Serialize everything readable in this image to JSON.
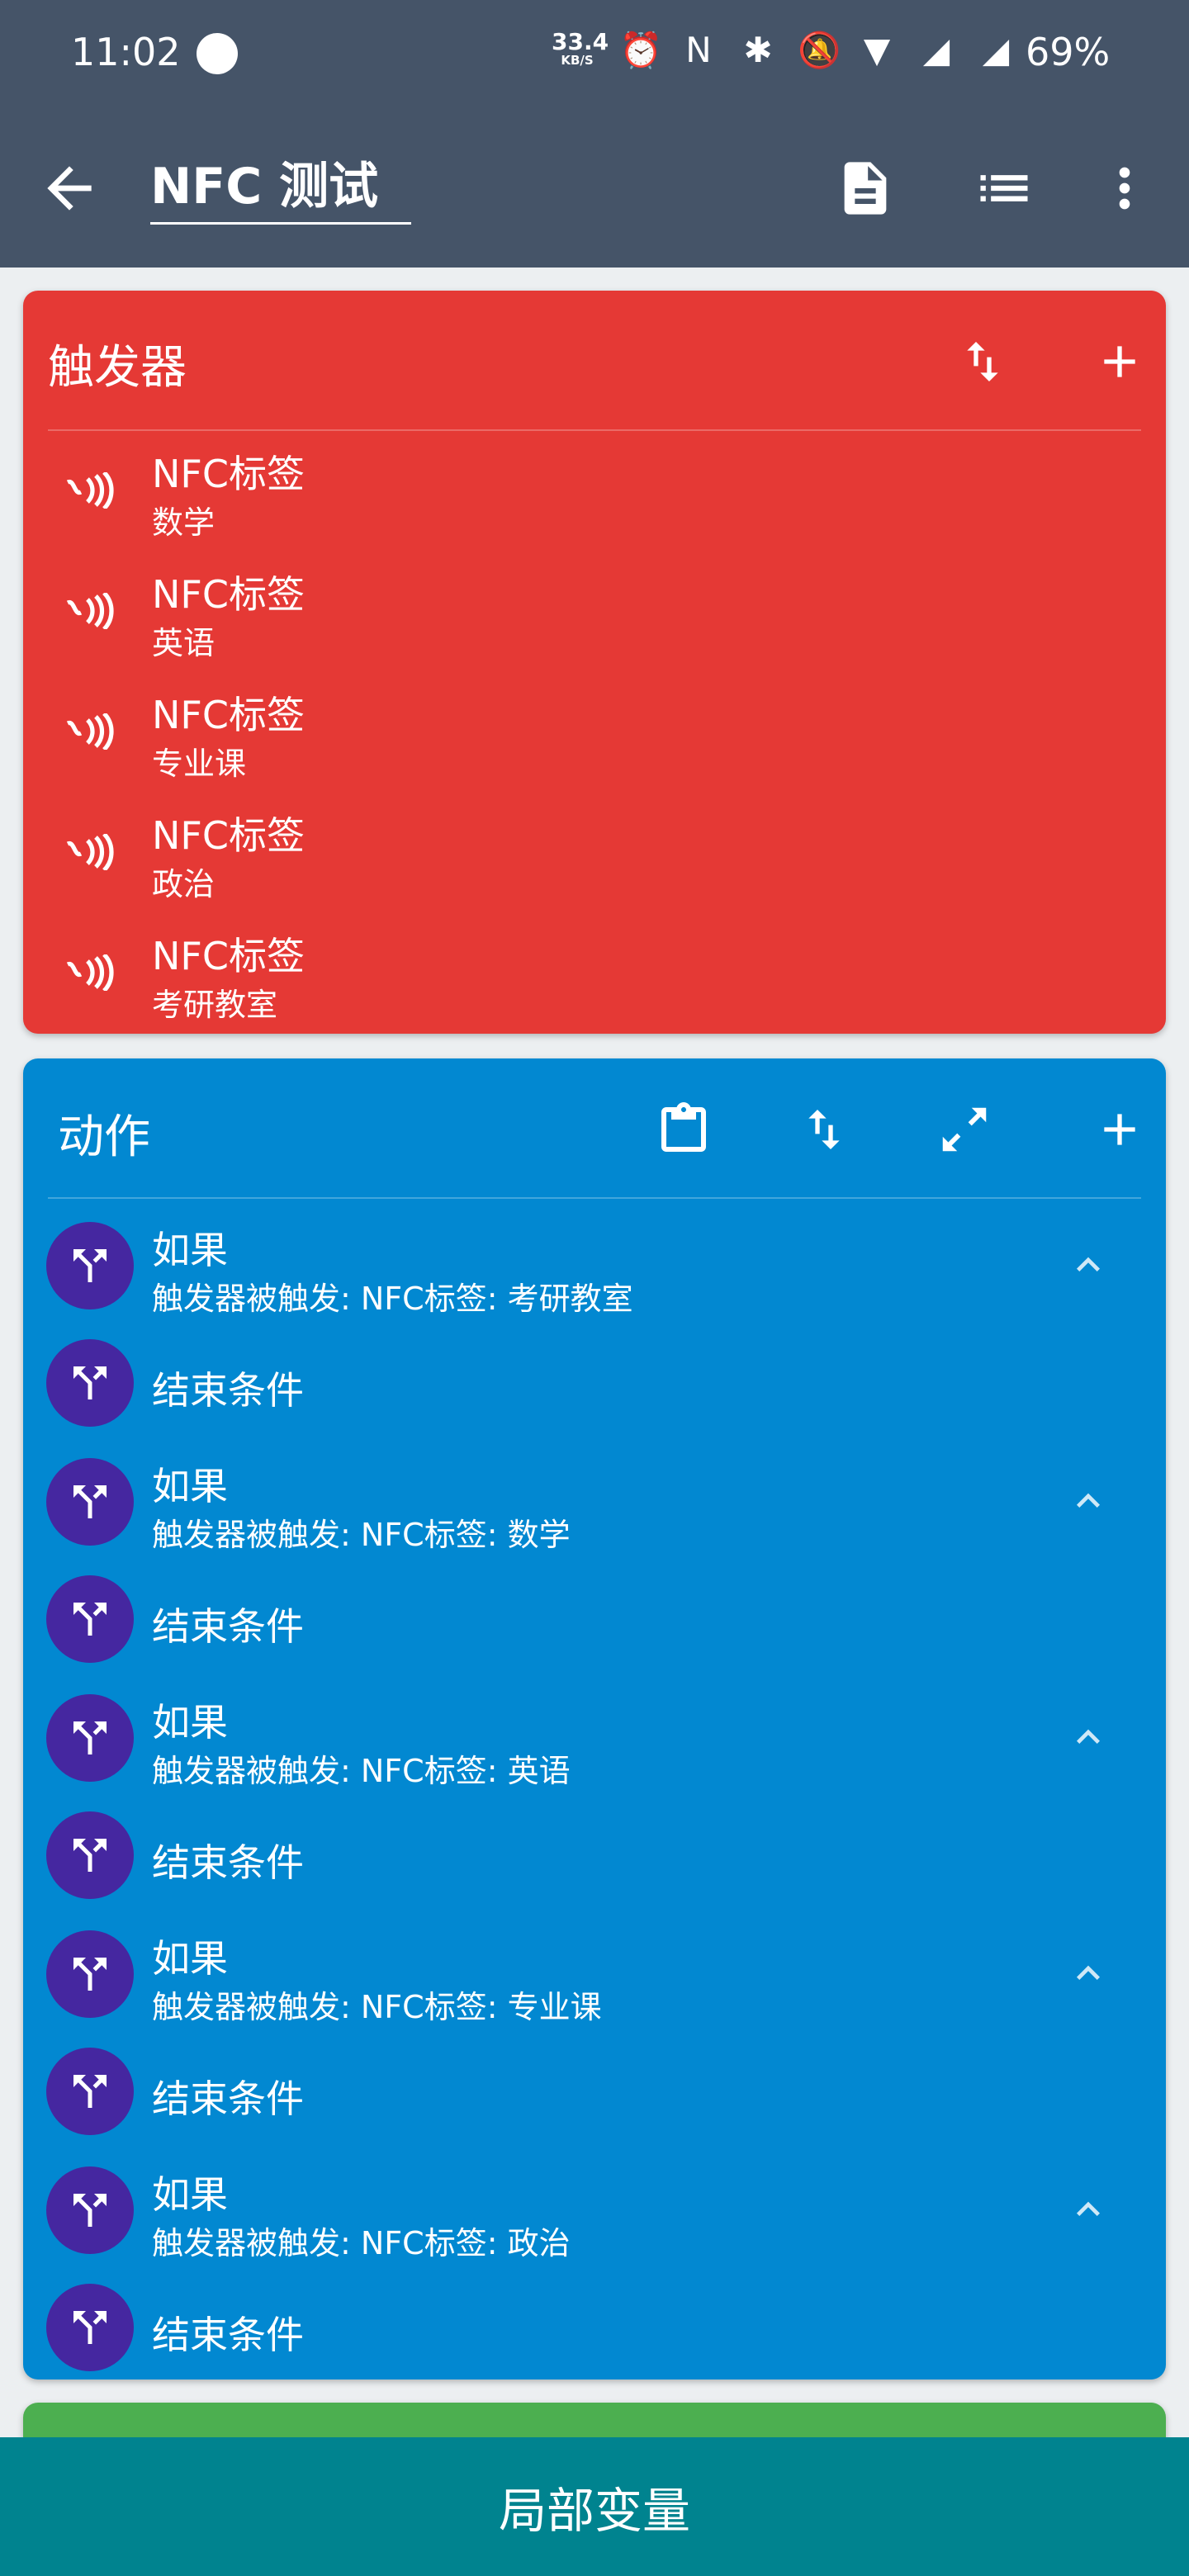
{
  "status": {
    "time": "11:02",
    "net_speed": "33.4",
    "net_unit": "KB/S",
    "battery": "69%",
    "icons": [
      "alarm-icon",
      "nfc-icon",
      "bluetooth-icon",
      "mute-icon",
      "wifi-icon",
      "signal-icon",
      "signal-icon"
    ]
  },
  "toolbar": {
    "title": "NFC 测试",
    "icons": [
      "back-arrow-icon",
      "document-icon",
      "list-icon",
      "more-vert-icon"
    ]
  },
  "triggers": {
    "title": "触发器",
    "items": [
      {
        "title": "NFC标签",
        "subtitle": "数学"
      },
      {
        "title": "NFC标签",
        "subtitle": "英语"
      },
      {
        "title": "NFC标签",
        "subtitle": "专业课"
      },
      {
        "title": "NFC标签",
        "subtitle": "政治"
      },
      {
        "title": "NFC标签",
        "subtitle": "考研教室"
      }
    ]
  },
  "actions": {
    "title": "动作",
    "items": [
      {
        "title": "如果",
        "subtitle": "触发器被触发: NFC标签: 考研教室"
      },
      {
        "title": "结束条件"
      },
      {
        "title": "如果",
        "subtitle": "触发器被触发: NFC标签: 数学"
      },
      {
        "title": "结束条件"
      },
      {
        "title": "如果",
        "subtitle": "触发器被触发: NFC标签: 英语"
      },
      {
        "title": "结束条件"
      },
      {
        "title": "如果",
        "subtitle": "触发器被触发: NFC标签: 专业课"
      },
      {
        "title": "结束条件"
      },
      {
        "title": "如果",
        "subtitle": "触发器被触发: NFC标签: 政治"
      },
      {
        "title": "结束条件"
      }
    ]
  },
  "bottom_bar": {
    "label": "局部变量"
  },
  "colors": {
    "toolbar": "#455468",
    "trigger_card": "#e53935",
    "action_card": "#0288d1",
    "constraint_card": "#4caf50",
    "bottom_bar": "#00838f",
    "action_avatar": "#4527a0"
  }
}
